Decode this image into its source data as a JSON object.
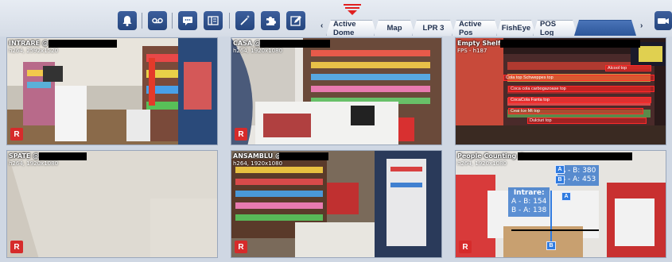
{
  "toolbar": {
    "buttons": [
      {
        "icon": "bell-icon"
      },
      {
        "icon": "voicemail-icon"
      },
      {
        "icon": "chat-icon"
      },
      {
        "icon": "layout-icon"
      },
      {
        "icon": "magic-wand-icon"
      },
      {
        "icon": "puzzle-icon"
      },
      {
        "icon": "edit-icon"
      }
    ],
    "right_button_icon": "camera-icon",
    "accent_color": "#2c5699"
  },
  "tabs": {
    "prev_arrow": "‹",
    "next_arrow": "›",
    "items": [
      {
        "label": "Active Dome",
        "active": false
      },
      {
        "label": "Map",
        "active": false
      },
      {
        "label": "LPR 3",
        "active": false
      },
      {
        "label": "Active Pos",
        "active": false
      },
      {
        "label": "FishEye",
        "active": false
      },
      {
        "label": "POS Log",
        "active": false
      },
      {
        "label": "",
        "active": true
      }
    ]
  },
  "cameras": [
    {
      "title": "INTRARE @",
      "sub": "h264, 2592x1520",
      "rec": "R"
    },
    {
      "title": "CASA @",
      "sub": "h264, 1920x1080",
      "rec": "R"
    },
    {
      "title": "Empty Shelf @",
      "sub": "FPS - h187",
      "rec": "",
      "tags": [
        "Alcool top",
        "Cola top Schweppes top",
        "Coca cola carbogazoase top",
        "CocaCola Fanta top",
        "Ceai Ice Mt top",
        "Dulciuri top"
      ]
    },
    {
      "title": "SPATE @",
      "sub": "h264, 1920x1080",
      "rec": "R"
    },
    {
      "title": "ANSAMBLU @",
      "sub": "h264, 1920x1080",
      "rec": "R"
    },
    {
      "title": "People Counting @",
      "sub": "h264, 1920x1080",
      "rec": "R",
      "counter_top": {
        "line1": "A - B: 380",
        "line2": "B - A: 453"
      },
      "counter_main": {
        "label": "Intrare:",
        "line1": "A - B: 154",
        "line2": "B - A: 138"
      },
      "markers": [
        "A",
        "B",
        "A",
        "B"
      ]
    }
  ],
  "colors": {
    "rec": "#d62b2b",
    "overlay_blue": "#2f7be0",
    "shelf_red": "#ff2a2a"
  }
}
